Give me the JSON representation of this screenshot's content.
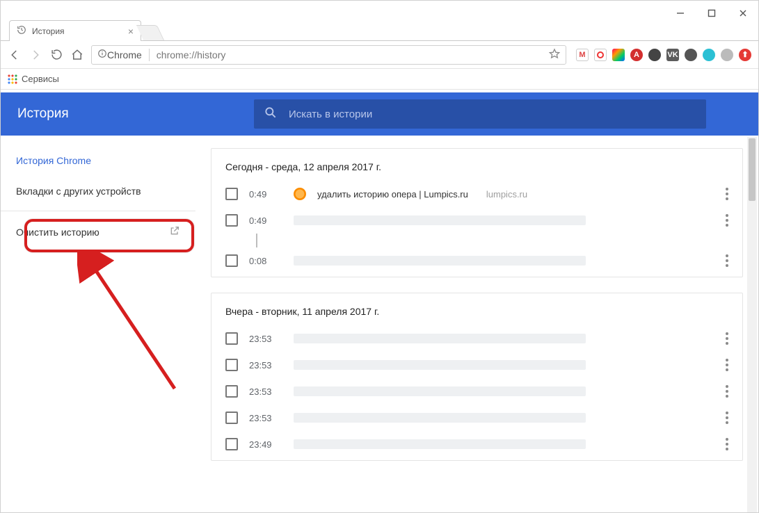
{
  "window": {
    "tab_title": "История"
  },
  "toolbar": {
    "chip_label": "Chrome",
    "url": "chrome://history"
  },
  "bookmarks": {
    "apps_label": "Сервисы"
  },
  "header": {
    "title": "История",
    "search_placeholder": "Искать в истории"
  },
  "sidebar": {
    "chrome_history": "История Chrome",
    "other_devices": "Вкладки с других устройств",
    "clear_history": "Очистить историю"
  },
  "groups": [
    {
      "title": "Сегодня - среда, 12 апреля 2017 г.",
      "rows": [
        {
          "time": "0:49",
          "title": "удалить историю опера | Lumpics.ru",
          "domain": "lumpics.ru",
          "favicon": true
        },
        {
          "time": "0:49",
          "placeholder": true,
          "threaded": true
        },
        {
          "time": "0:08",
          "placeholder": true
        }
      ]
    },
    {
      "title": "Вчера - вторник, 11 апреля 2017 г.",
      "rows": [
        {
          "time": "23:53",
          "placeholder": true
        },
        {
          "time": "23:53",
          "placeholder": true
        },
        {
          "time": "23:53",
          "placeholder": true
        },
        {
          "time": "23:53",
          "placeholder": true
        },
        {
          "time": "23:49",
          "placeholder": true
        }
      ]
    }
  ]
}
